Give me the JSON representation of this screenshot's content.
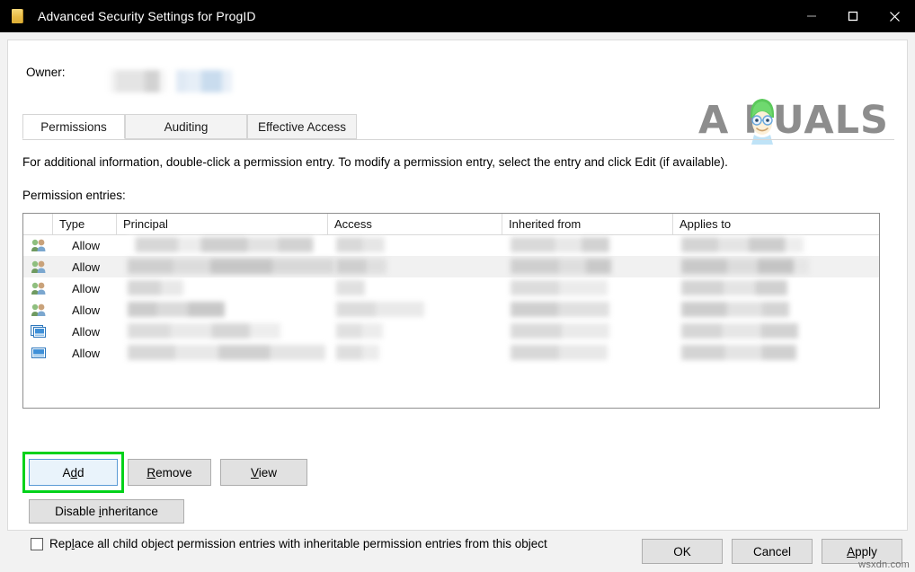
{
  "window": {
    "title": "Advanced Security Settings for ProgID",
    "icon": "folder-icon",
    "controls": {
      "minimize": "minimize-icon",
      "maximize": "maximize-icon",
      "close": "close-icon"
    }
  },
  "owner": {
    "label": "Owner:",
    "value_redacted": true,
    "change_link_redacted": true
  },
  "branding": {
    "logo_text_prefix": "A",
    "logo_text_suffix": "PUALS",
    "logo_color": "#8d8d8d",
    "mascot_hair_color": "#5bc95b"
  },
  "tabs": [
    {
      "label": "Permissions",
      "active": true
    },
    {
      "label": "Auditing",
      "active": false
    },
    {
      "label": "Effective Access",
      "active": false
    }
  ],
  "main": {
    "info_text": "For additional information, double-click a permission entry. To modify a permission entry, select the entry and click Edit (if available).",
    "entries_label": "Permission entries:"
  },
  "table": {
    "columns": [
      "Type",
      "Principal",
      "Access",
      "Inherited from",
      "Applies to"
    ],
    "rows": [
      {
        "icon": "users-group-icon",
        "type": "Allow",
        "selected": false
      },
      {
        "icon": "users-group-icon",
        "type": "Allow",
        "selected": true
      },
      {
        "icon": "users-group-icon",
        "type": "Allow",
        "selected": false
      },
      {
        "icon": "users-group-icon",
        "type": "Allow",
        "selected": false
      },
      {
        "icon": "computer-stack-icon",
        "type": "Allow",
        "selected": false
      },
      {
        "icon": "computer-icon",
        "type": "Allow",
        "selected": false
      }
    ]
  },
  "actions": {
    "add": "Add",
    "add_mnemonic": "d",
    "remove": "Remove",
    "remove_mnemonic": "R",
    "view": "View",
    "view_mnemonic": "V",
    "disable_inheritance": "Disable inheritance",
    "disable_inheritance_mnemonic": "i",
    "highlight_color": "#00d21a"
  },
  "checkbox": {
    "label": "Replace all child object permission entries with inheritable permission entries from this object",
    "checked": false,
    "mnemonic": "l"
  },
  "footer": {
    "ok": "OK",
    "cancel": "Cancel",
    "apply": "Apply",
    "apply_enabled": false
  },
  "watermark": "wsxdn.com"
}
